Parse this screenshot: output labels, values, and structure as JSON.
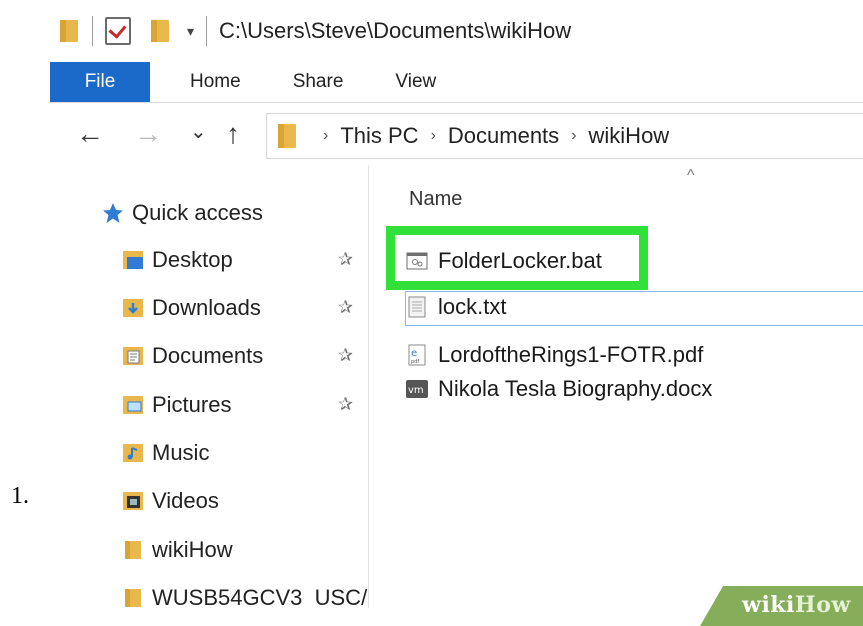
{
  "step_number": "1.",
  "window": {
    "title_path": "C:\\Users\\Steve\\Documents\\wikiHow",
    "qat_dropdown": "▾"
  },
  "ribbon": {
    "tabs": [
      {
        "label": "File"
      },
      {
        "label": "Home"
      },
      {
        "label": "Share"
      },
      {
        "label": "View"
      }
    ]
  },
  "address": {
    "back": "←",
    "forward": "→",
    "recent": "⌄",
    "up": "↑",
    "crumbs": [
      "This PC",
      "Documents",
      "wikiHow"
    ],
    "crumb_sep": "›"
  },
  "nav": {
    "quick_access": "Quick access",
    "items": [
      {
        "label": "Desktop",
        "icon": "desktop-folder-icon",
        "pinned": true
      },
      {
        "label": "Downloads",
        "icon": "downloads-folder-icon",
        "pinned": true
      },
      {
        "label": "Documents",
        "icon": "documents-folder-icon",
        "pinned": true
      },
      {
        "label": "Pictures",
        "icon": "pictures-folder-icon",
        "pinned": true
      },
      {
        "label": "Music",
        "icon": "music-folder-icon",
        "pinned": false
      },
      {
        "label": "Videos",
        "icon": "videos-folder-icon",
        "pinned": false
      },
      {
        "label": "wikiHow",
        "icon": "folder-icon",
        "pinned": false
      },
      {
        "label": "WUSB54GCV3_USC/",
        "icon": "folder-icon",
        "pinned": false
      }
    ],
    "pin_glyph": "📌"
  },
  "content": {
    "column_name": "Name",
    "sort_caret": "^",
    "files": [
      {
        "name": "FolderLocker.bat",
        "icon": "batch-file-icon"
      },
      {
        "name": "lock.txt",
        "icon": "text-file-icon"
      },
      {
        "name": "LordoftheRings1-FOTR.pdf",
        "icon": "pdf-file-icon"
      },
      {
        "name": "Nikola Tesla Biography.docx",
        "icon": "docx-file-icon"
      }
    ]
  },
  "watermark": {
    "wiki": "wiki",
    "how": "How"
  },
  "colors": {
    "file_tab": "#1b6ac9",
    "highlight": "#32e03a",
    "folder": "#e8b84c",
    "watermark": "#86ad5a"
  }
}
